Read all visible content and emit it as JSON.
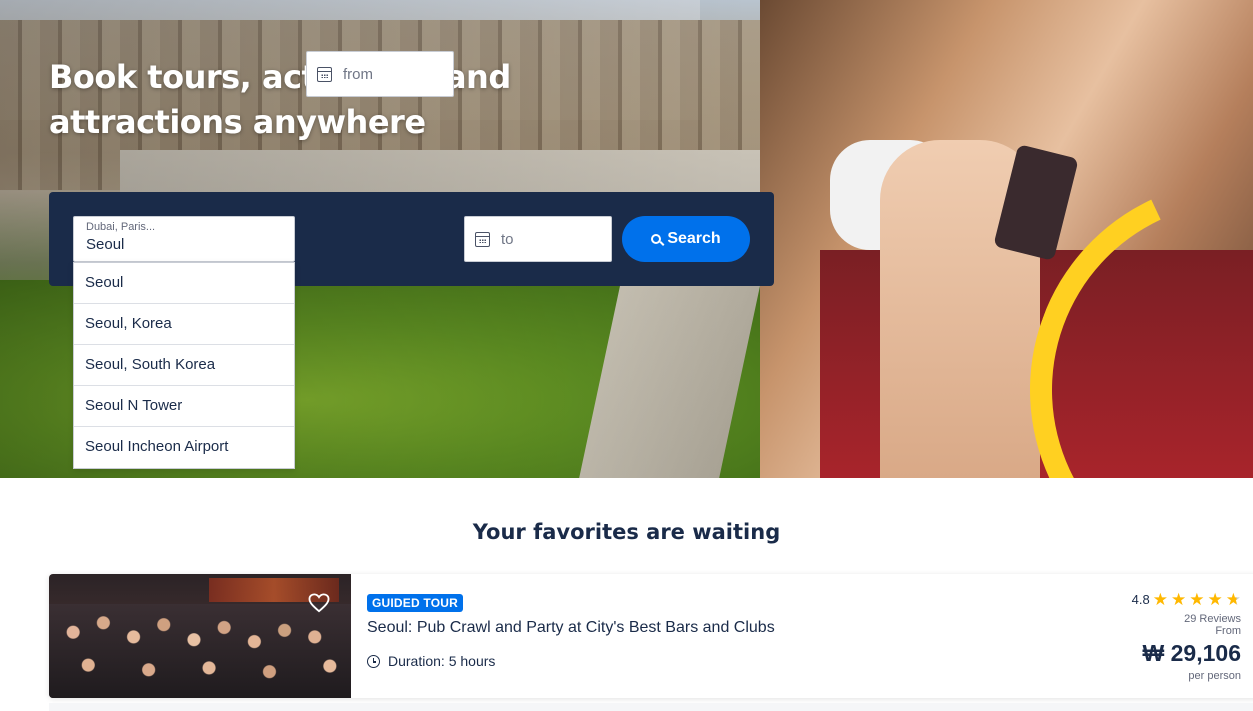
{
  "hero": {
    "title": "Book tours, activities, and attractions anywhere"
  },
  "search": {
    "destination_placeholder": "Dubai, Paris...",
    "destination_value": "Seoul",
    "from_label": "from",
    "to_label": "to",
    "search_label": "Search",
    "suggestions": [
      "Seoul",
      "Seoul, Korea",
      "Seoul, South Korea",
      "Seoul N Tower",
      "Seoul Incheon Airport"
    ]
  },
  "favorites": {
    "heading": "Your favorites are waiting",
    "card": {
      "badge": "GUIDED TOUR",
      "title": "Seoul: Pub Crawl and Party at City's Best Bars and Clubs",
      "duration": "Duration: 5 hours",
      "rating": "4.8",
      "rating_stars": 4.8,
      "reviews": "29 Reviews",
      "from_label": "From",
      "price": "₩ 29,106",
      "per_person": "per person"
    }
  },
  "icons": {
    "calendar": "calendar-icon",
    "search": "search-icon",
    "heart": "heart-icon",
    "clock": "clock-icon",
    "star": "star-icon"
  },
  "colors": {
    "navy": "#1a2b49",
    "accent_blue": "#0071eb",
    "star_yellow": "#ffb800",
    "brand_yellow": "#ffd021"
  }
}
